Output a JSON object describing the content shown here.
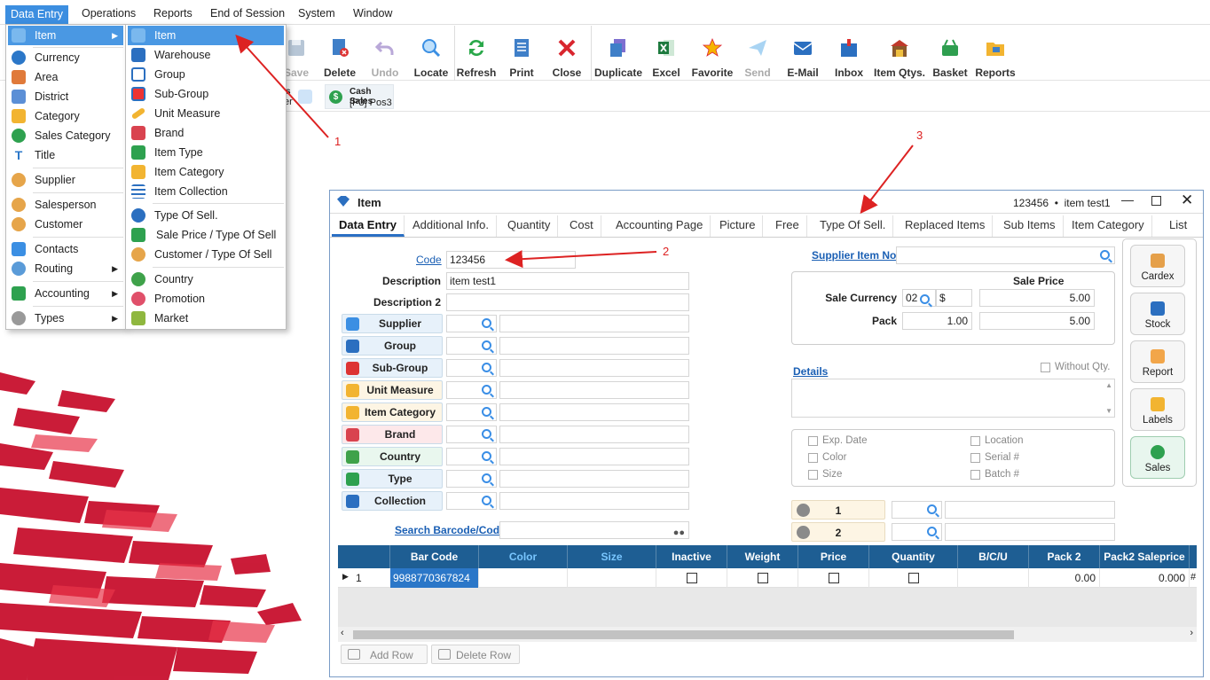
{
  "menubar": {
    "items": [
      "Data Entry",
      "Operations",
      "Reports",
      "End of Session",
      "System",
      "Window"
    ]
  },
  "toolbar": {
    "buttons": [
      {
        "label": "Save",
        "icon": "save-icon",
        "disabled": true
      },
      {
        "label": "Delete",
        "icon": "delete-icon",
        "disabled": false
      },
      {
        "label": "Undo",
        "icon": "undo-icon",
        "disabled": true
      },
      {
        "label": "Locate",
        "icon": "search-icon",
        "disabled": false
      },
      {
        "label": "Refresh",
        "icon": "refresh-icon",
        "disabled": false
      },
      {
        "label": "Print",
        "icon": "print-icon",
        "disabled": false
      },
      {
        "label": "Close",
        "icon": "close-icon",
        "disabled": false
      },
      {
        "label": "Duplicate",
        "icon": "duplicate-icon",
        "disabled": false
      },
      {
        "label": "Excel",
        "icon": "excel-icon",
        "disabled": false
      },
      {
        "label": "Favorite",
        "icon": "star-icon",
        "disabled": false
      },
      {
        "label": "Send",
        "icon": "send-icon",
        "disabled": true
      },
      {
        "label": "E-Mail",
        "icon": "email-icon",
        "disabled": false
      },
      {
        "label": "Inbox",
        "icon": "inbox-icon",
        "disabled": false
      },
      {
        "label": "Item Qtys.",
        "icon": "warehouse-icon",
        "disabled": false
      },
      {
        "label": "Basket",
        "icon": "basket-icon",
        "disabled": false
      },
      {
        "label": "Reports",
        "icon": "folder-icon",
        "disabled": false
      }
    ]
  },
  "open_tabs": {
    "partial_label_top": "s",
    "partial_label_bottom": "er",
    "cash_sales_title": "Cash Sales",
    "cash_sales_sub": "[P3] Pos3"
  },
  "menu1": {
    "items": [
      {
        "label": "Item",
        "icon": "item-icon",
        "submenu": true,
        "selected": true
      },
      {
        "label": "Currency",
        "icon": "currency-icon"
      },
      {
        "label": "Area",
        "icon": "area-icon"
      },
      {
        "label": "District",
        "icon": "district-icon"
      },
      {
        "label": "Category",
        "icon": "category-icon"
      },
      {
        "label": "Sales Category",
        "icon": "sales-category-icon"
      },
      {
        "label": "Title",
        "icon": "title-icon"
      },
      {
        "label": "Supplier",
        "icon": "supplier-icon"
      },
      {
        "label": "Salesperson",
        "icon": "salesperson-icon"
      },
      {
        "label": "Customer",
        "icon": "customer-icon"
      },
      {
        "label": "Contacts",
        "icon": "contacts-icon"
      },
      {
        "label": "Routing",
        "icon": "routing-icon",
        "submenu": true
      },
      {
        "label": "Accounting",
        "icon": "accounting-icon",
        "submenu": true
      },
      {
        "label": "Types",
        "icon": "types-icon",
        "submenu": true
      }
    ]
  },
  "menu2": {
    "items": [
      {
        "label": "Item",
        "icon": "item-icon",
        "selected": true
      },
      {
        "label": "Warehouse",
        "icon": "warehouse-icon"
      },
      {
        "label": "Group",
        "icon": "group-icon"
      },
      {
        "label": "Sub-Group",
        "icon": "sub-group-icon"
      },
      {
        "label": "Unit Measure",
        "icon": "ruler-icon"
      },
      {
        "label": "Brand",
        "icon": "brand-icon"
      },
      {
        "label": "Item Type",
        "icon": "item-type-icon"
      },
      {
        "label": "Item Category",
        "icon": "folder-icon"
      },
      {
        "label": "Item Collection",
        "icon": "list-icon"
      },
      {
        "label": "Type Of Sell.",
        "icon": "type-of-sell-icon"
      },
      {
        "label": "Sale Price / Type Of Sell",
        "icon": "price-icon"
      },
      {
        "label": "Customer / Type Of Sell",
        "icon": "customer-icon"
      },
      {
        "label": "Country",
        "icon": "country-icon"
      },
      {
        "label": "Promotion",
        "icon": "promotion-icon"
      },
      {
        "label": "Market",
        "icon": "market-icon"
      }
    ]
  },
  "annotations": {
    "a1": "1",
    "a2": "2",
    "a3": "3"
  },
  "window": {
    "title": "Item",
    "record": "123456  •  item test1",
    "tabs": [
      "Data Entry",
      "Additional Info.",
      "Quantity",
      "Cost",
      "Accounting Page",
      "Picture",
      "Free",
      "Type Of Sell.",
      "Replaced Items",
      "Sub Items",
      "Item Category",
      "List"
    ],
    "code_label": "Code",
    "code_value": "123456",
    "description_label": "Description",
    "description_value": "item test1",
    "description2_label": "Description 2",
    "description2_value": "",
    "lookups": [
      {
        "label": "Supplier",
        "icon": "supplier-icon"
      },
      {
        "label": "Group",
        "icon": "group-icon"
      },
      {
        "label": "Sub-Group",
        "icon": "sub-group-icon"
      },
      {
        "label": "Unit Measure",
        "icon": "ruler-icon"
      },
      {
        "label": "Item Category",
        "icon": "folder-icon"
      },
      {
        "label": "Brand",
        "icon": "brand-icon"
      },
      {
        "label": "Country",
        "icon": "country-icon"
      },
      {
        "label": "Type",
        "icon": "item-type-icon"
      },
      {
        "label": "Collection",
        "icon": "list-icon"
      }
    ],
    "search_barcode_label": "Search Barcode/Code",
    "supplier_item_no_label": "Supplier Item No",
    "sale_price_header": "Sale Price",
    "sale_currency_label": "Sale Currency",
    "sale_currency_code": "02",
    "sale_currency_symbol": "$",
    "sale_price_value": "5.00",
    "pack_label": "Pack",
    "pack_value": "1.00",
    "pack_price": "5.00",
    "details_label": "Details",
    "without_qty_label": "Without Qty.",
    "options_left": [
      "Exp. Date",
      "Color",
      "Size"
    ],
    "options_right": [
      "Location",
      "Serial #",
      "Batch #"
    ],
    "extra1_label": "1",
    "extra2_label": "2",
    "side_buttons": [
      {
        "label": "Cardex",
        "icon": "cardex-icon"
      },
      {
        "label": "Stock",
        "icon": "stock-icon"
      },
      {
        "label": "Report",
        "icon": "report-icon"
      },
      {
        "label": "Labels",
        "icon": "labels-icon"
      },
      {
        "label": "Sales",
        "icon": "sales-icon"
      }
    ],
    "grid": {
      "columns": [
        "Bar Code",
        "Color",
        "Size",
        "Inactive",
        "Weight",
        "Price",
        "Quantity",
        "B/C/U",
        "Pack 2",
        "Pack2 Saleprice"
      ],
      "row": {
        "index": "1",
        "barcode": "9988770367824",
        "pack2": "0.00",
        "pack2_saleprice": "0.000",
        "overflow": "#"
      }
    },
    "add_row_label": "Add Row",
    "delete_row_label": "Delete Row"
  },
  "colors": {
    "accent": "#3c8ee0",
    "grid_header": "#1e5e93",
    "annotation": "#dd2222"
  }
}
